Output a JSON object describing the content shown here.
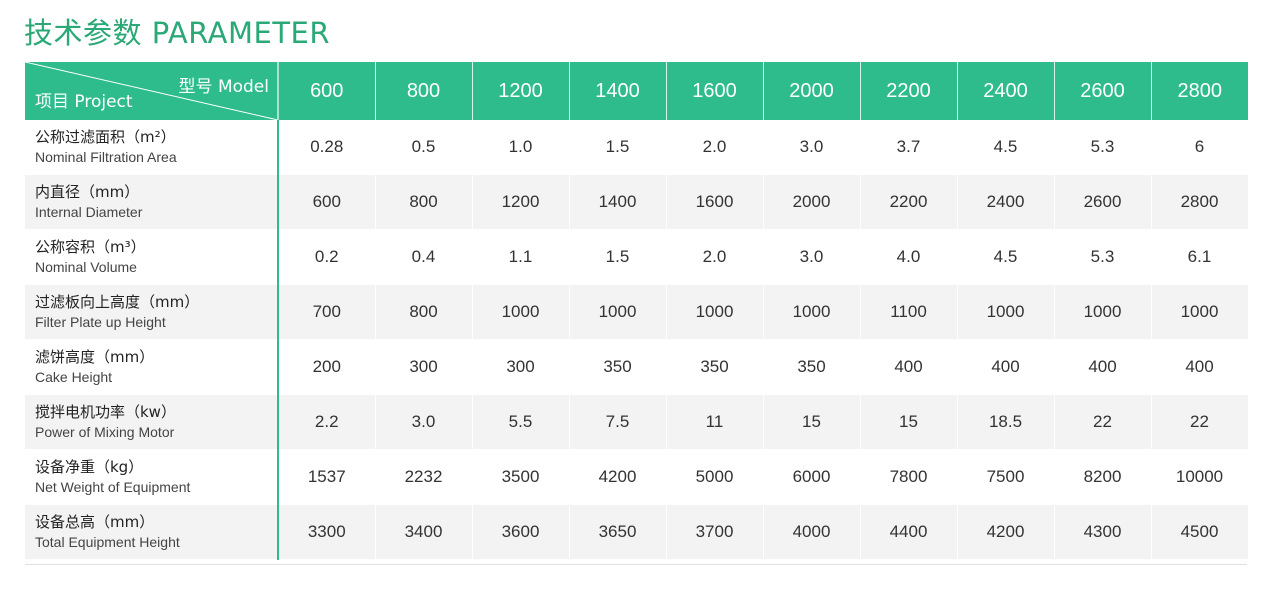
{
  "title": "技术参数 PARAMETER",
  "header": {
    "model_label": "型号 Model",
    "project_label": "项目 Project",
    "models": [
      "600",
      "800",
      "1200",
      "1400",
      "1600",
      "2000",
      "2200",
      "2400",
      "2600",
      "2800"
    ]
  },
  "rows": [
    {
      "cn": "公称过滤面积（m²）",
      "en": "Nominal Filtration Area",
      "values": [
        "0.28",
        "0.5",
        "1.0",
        "1.5",
        "2.0",
        "3.0",
        "3.7",
        "4.5",
        "5.3",
        "6"
      ]
    },
    {
      "cn": "内直径（mm）",
      "en": "Internal Diameter",
      "values": [
        "600",
        "800",
        "1200",
        "1400",
        "1600",
        "2000",
        "2200",
        "2400",
        "2600",
        "2800"
      ]
    },
    {
      "cn": "公称容积（m³）",
      "en": "Nominal Volume",
      "values": [
        "0.2",
        "0.4",
        "1.1",
        "1.5",
        "2.0",
        "3.0",
        "4.0",
        "4.5",
        "5.3",
        "6.1"
      ]
    },
    {
      "cn": "过滤板向上高度（mm）",
      "en": "Filter Plate up Height",
      "values": [
        "700",
        "800",
        "1000",
        "1000",
        "1000",
        "1000",
        "1100",
        "1000",
        "1000",
        "1000"
      ]
    },
    {
      "cn": "滤饼高度（mm）",
      "en": "Cake Height",
      "values": [
        "200",
        "300",
        "300",
        "350",
        "350",
        "350",
        "400",
        "400",
        "400",
        "400"
      ]
    },
    {
      "cn": "搅拌电机功率（kw）",
      "en": "Power of Mixing Motor",
      "values": [
        "2.2",
        "3.0",
        "5.5",
        "7.5",
        "11",
        "15",
        "15",
        "18.5",
        "22",
        "22"
      ]
    },
    {
      "cn": "设备净重（kg）",
      "en": "Net Weight of Equipment",
      "values": [
        "1537",
        "2232",
        "3500",
        "4200",
        "5000",
        "6000",
        "7800",
        "7500",
        "8200",
        "10000"
      ]
    },
    {
      "cn": "设备总高（mm）",
      "en": "Total Equipment Height",
      "values": [
        "3300",
        "3400",
        "3600",
        "3650",
        "3700",
        "4000",
        "4400",
        "4200",
        "4300",
        "4500"
      ]
    }
  ],
  "colors": {
    "accent": "#2ebc8d",
    "title": "#2aa876",
    "row_alt": "#f3f3f3"
  }
}
